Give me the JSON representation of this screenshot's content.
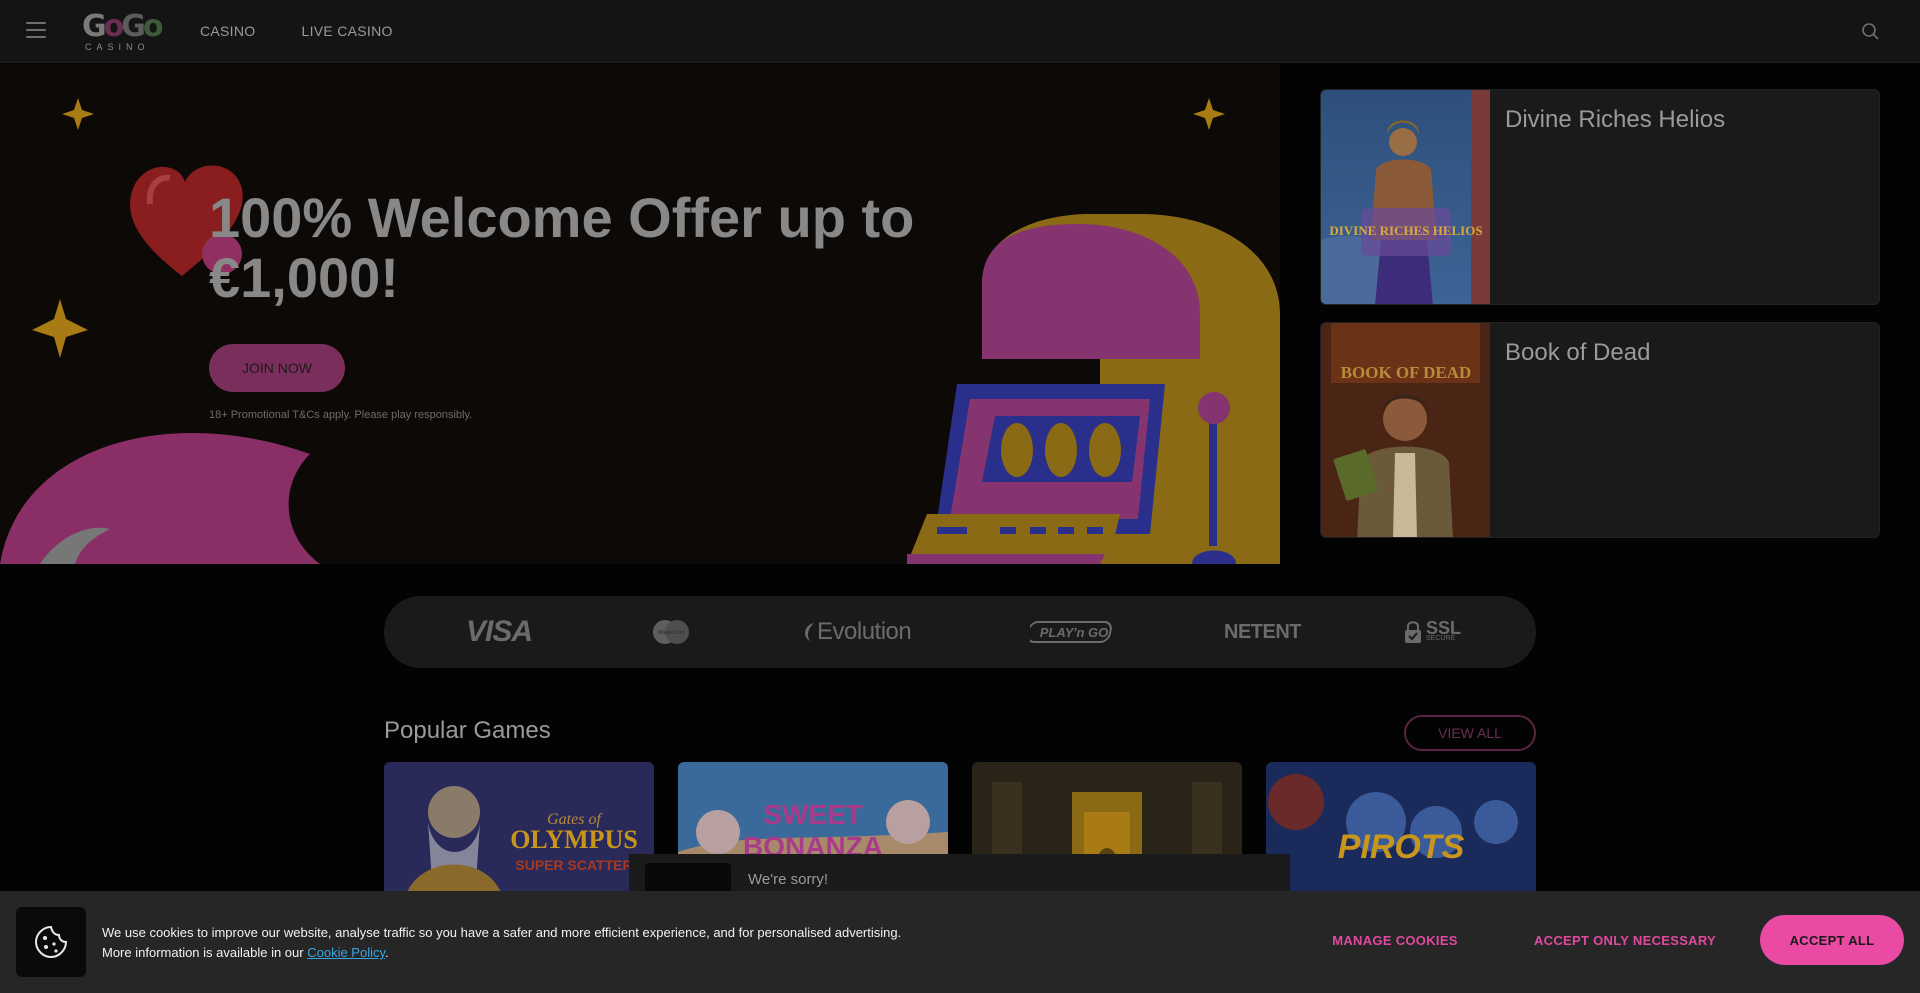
{
  "header": {
    "logo_text": {
      "g1": "G",
      "o1": "o",
      "g2": "G",
      "o2": "o",
      "sub": "CASINO"
    },
    "nav": [
      {
        "label": "CASINO"
      },
      {
        "label": "LIVE CASINO"
      }
    ]
  },
  "hero": {
    "title": "100% Welcome Offer up to €1,000!",
    "cta": "JOIN NOW",
    "terms": "18+ Promotional T&Cs apply. Please play responsibly."
  },
  "featured_games": [
    {
      "name": "Divine Riches Helios",
      "thumb_text": "DIVINE RICHES HELIOS"
    },
    {
      "name": "Book of Dead",
      "thumb_text": "BOOK OF DEAD"
    }
  ],
  "providers": {
    "visa": "VISA",
    "mastercard": "MasterCard",
    "evolution": "Evolution",
    "playngo": "PLAY'n GO",
    "netent": "NETENT",
    "ssl": "SSL",
    "ssl_sub": "SECURE"
  },
  "popular": {
    "title": "Popular Games",
    "view_all": "VIEW ALL",
    "games": [
      {
        "name": "Gates of Olympus Super Scatter",
        "title_line1": "Gates of",
        "title_line2": "OLYMPUS",
        "title_line3": "SUPER SCATTER"
      },
      {
        "name": "Sweet Bonanza",
        "title_line1": "SWEET",
        "title_line2": "BONANZA"
      },
      {
        "name": "Egyptian slot"
      },
      {
        "name": "Pirots",
        "title_line1": "PIROTS"
      }
    ]
  },
  "toast": {
    "text": "We're sorry!"
  },
  "cookie_banner": {
    "line1": "We use cookies to improve our website, analyse traffic so you have a safer and more efficient experience, and for personalised advertising.",
    "line2_prefix": "More information is available in our ",
    "link": "Cookie Policy",
    "line2_suffix": ".",
    "manage": "MANAGE COOKIES",
    "necessary": "ACCEPT ONLY NECESSARY",
    "accept_all": "ACCEPT ALL"
  },
  "colors": {
    "accent": "#ea4aa3",
    "link": "#3aa6e0",
    "background": "#030303",
    "gold": "#c9961c"
  }
}
